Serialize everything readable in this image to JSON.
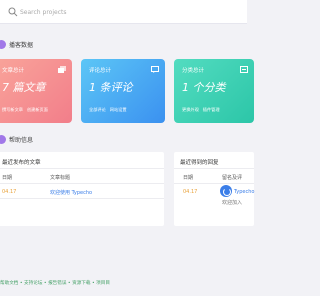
{
  "search": {
    "placeholder": "Search projects"
  },
  "sections": {
    "stats": "播客数据",
    "guide": "帮助信息"
  },
  "cards": [
    {
      "label": "文章总计",
      "value": "7 篇文章",
      "links": [
        "撰写新文章",
        "创建新页面"
      ],
      "color": "#f27e8a"
    },
    {
      "label": "评论总计",
      "value": "1 条评论",
      "links": [
        "全部评论",
        "网站设置"
      ],
      "color": "#3b91f0"
    },
    {
      "label": "分类总计",
      "value": "1 个分类",
      "links": [
        "更换外观",
        "插件管理"
      ],
      "color": "#2cc6a8"
    }
  ],
  "recent_posts": {
    "title": "最近发布的文章",
    "headers": [
      "日期",
      "文章标题"
    ],
    "rows": [
      {
        "date": "04.17",
        "title": "欢迎使用 Typecho"
      }
    ]
  },
  "recent_replies": {
    "title": "最近得到的回复",
    "headers": [
      "日期",
      "留名及评"
    ],
    "rows": [
      {
        "date": "04.17",
        "name": "Typecho",
        "text": "欢迎加入"
      }
    ]
  },
  "footer": {
    "links": [
      "帮助文档",
      "支持论坛",
      "报告错误",
      "资源下载",
      "项目目"
    ]
  }
}
